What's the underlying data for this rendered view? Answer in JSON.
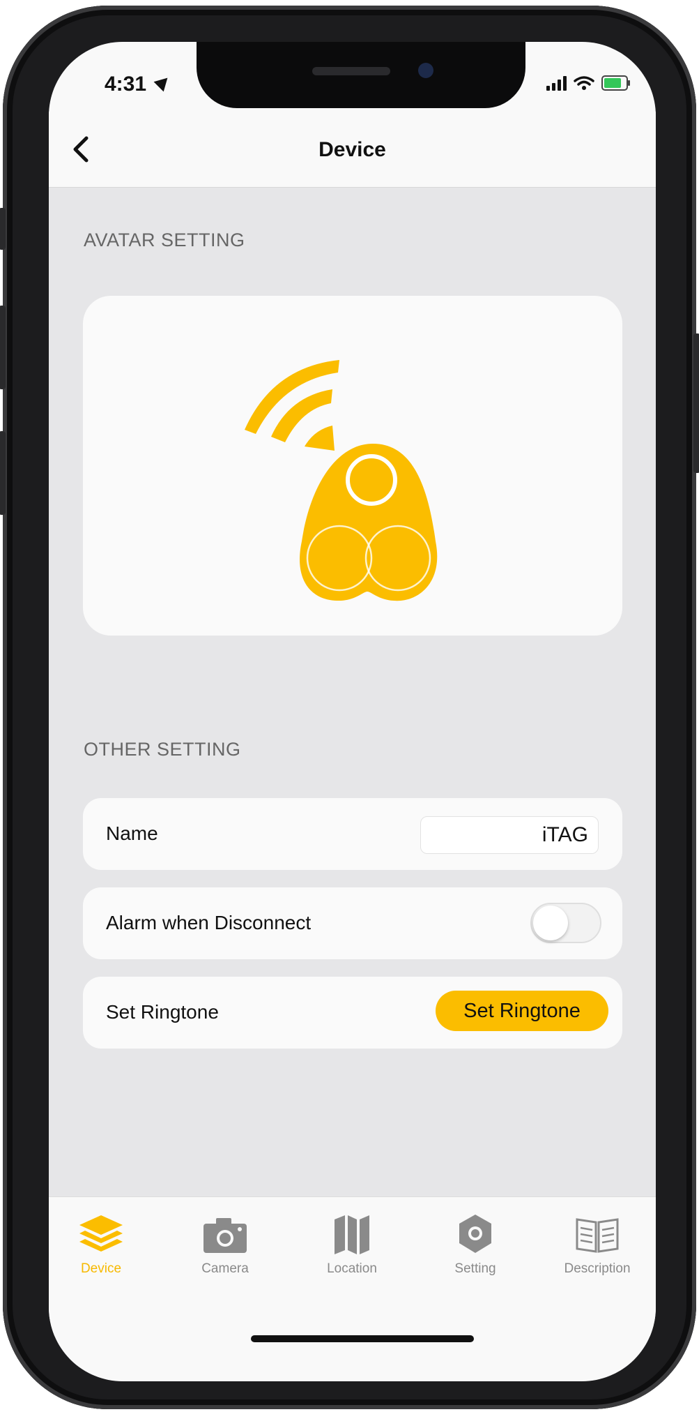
{
  "status_bar": {
    "time": "4:31"
  },
  "nav": {
    "title": "Device"
  },
  "sections": {
    "avatar": "AVATAR SETTING",
    "other": "OTHER SETTING"
  },
  "settings": {
    "name_label": "Name",
    "name_value": "iTAG",
    "alarm_label": "Alarm when Disconnect",
    "alarm_enabled": false,
    "ringtone_label": "Set Ringtone",
    "ringtone_button": "Set Ringtone"
  },
  "tabs": [
    {
      "label": "Device",
      "icon": "layers-icon",
      "active": true
    },
    {
      "label": "Camera",
      "icon": "camera-icon",
      "active": false
    },
    {
      "label": "Location",
      "icon": "map-icon",
      "active": false
    },
    {
      "label": "Setting",
      "icon": "gear-icon",
      "active": false
    },
    {
      "label": "Description",
      "icon": "book-icon",
      "active": false
    }
  ],
  "colors": {
    "accent": "#fbbd00",
    "background": "#e6e6e8",
    "card": "#fafafa"
  }
}
